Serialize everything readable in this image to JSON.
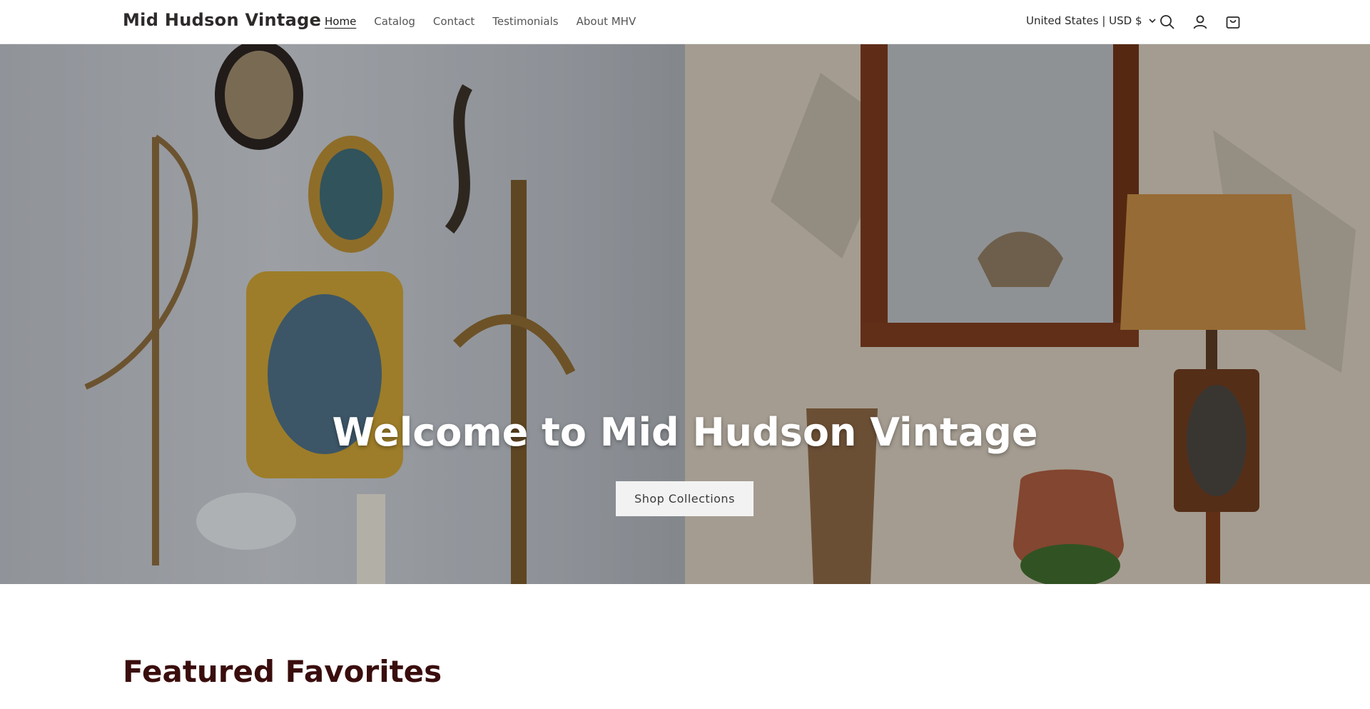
{
  "header": {
    "logo": "Mid Hudson Vintage",
    "nav": [
      {
        "label": "Home",
        "active": true
      },
      {
        "label": "Catalog",
        "active": false
      },
      {
        "label": "Contact",
        "active": false
      },
      {
        "label": "Testimonials",
        "active": false
      },
      {
        "label": "About MHV",
        "active": false
      }
    ],
    "locale": "United States | USD $",
    "icons": [
      "search-icon",
      "account-icon",
      "cart-icon",
      "chevron-down-icon"
    ]
  },
  "hero": {
    "title": "Welcome to Mid Hudson Vintage",
    "button_label": "Shop Collections"
  },
  "featured": {
    "title": "Featured Favorites"
  },
  "colors": {
    "heading_accent": "#3a0d0d",
    "button_bg": "#f2f2f2"
  }
}
